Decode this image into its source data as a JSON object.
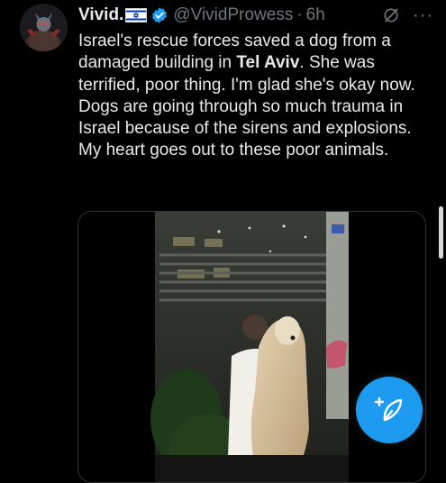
{
  "post": {
    "author_name": "Vivid.",
    "handle": "@VividProwess",
    "separator": "·",
    "time": "6h",
    "more_label": "···",
    "text_part1": "Israel's rescue forces saved a dog from a damaged building in ",
    "text_bold": "Tel Aviv",
    "text_part2": ". She was terrified, poor thing. I'm glad she's okay now. Dogs are going through so much trauma in Israel because of the sirens and explosions. My heart goes out to these poor animals."
  },
  "icons": {
    "avatar": "avatar-image",
    "flag": "israel-flag-icon",
    "verified": "verified-badge-icon",
    "grok": "grok-icon",
    "more": "more-icon",
    "compose": "compose-post-icon"
  },
  "colors": {
    "background": "#000000",
    "text": "#e7e9ea",
    "secondary": "#71767b",
    "accent": "#1d9bf0",
    "flag_blue": "#0038b8"
  }
}
